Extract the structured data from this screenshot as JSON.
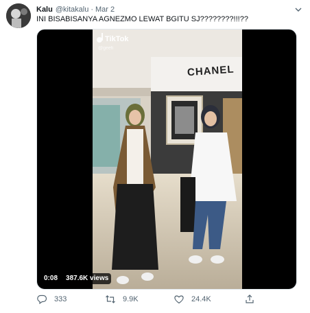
{
  "tweet": {
    "display_name": "Kalu",
    "handle": "@kitakalu",
    "separator": "·",
    "date": "Mar 2",
    "text": "INI BISABISANYA AGNEZMO LEWAT BGITU SJ????????!!!??"
  },
  "media": {
    "video_time": "0:08",
    "views": "387.6K views",
    "watermark_app": "TikTok",
    "watermark_user": "@geefi",
    "store_sign": "CHANEL"
  },
  "actions": {
    "replies": "333",
    "retweets": "9.9K",
    "likes": "24.4K"
  },
  "colors": {
    "text_primary": "#0f1419",
    "text_secondary": "#536471",
    "media_background": "#000000"
  }
}
